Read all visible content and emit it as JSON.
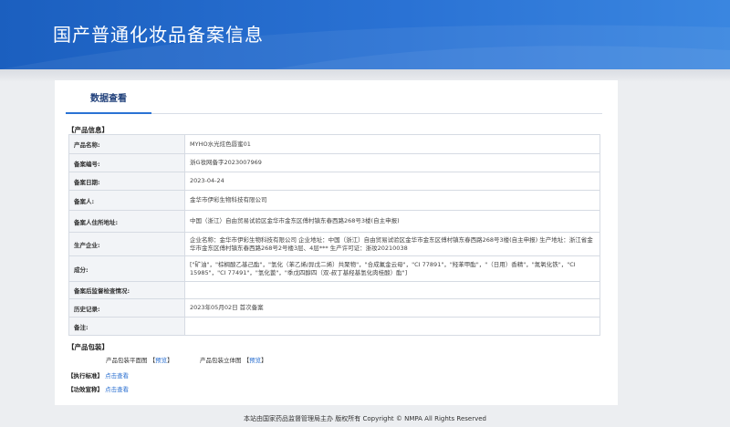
{
  "header": {
    "title": "国产普通化妆品备案信息"
  },
  "tabs": [
    {
      "label": "数据查看"
    }
  ],
  "product_info": {
    "section_title": "【产品信息】",
    "rows": [
      {
        "label": "产品名称:",
        "value": "MYHO水光炫色唇蜜01"
      },
      {
        "label": "备案编号:",
        "value": "浙G妆网备字2023007969"
      },
      {
        "label": "备案日期:",
        "value": "2023-04-24"
      },
      {
        "label": "备案人:",
        "value": "金华市伊彩生物科技有限公司"
      },
      {
        "label": "备案人住所地址:",
        "value": "中国（浙江）自由贸易试验区金华市金东区傅村镇东春西路268号3楼(自主申报)"
      },
      {
        "label": "生产企业:",
        "value": "企业名称：金华市伊彩生物科技有限公司 企业地址：中国（浙江）自由贸易试验区金华市金东区傅村镇东春西路268号3楼(自主申报) 生产地址：浙江省金华市金东区傅村镇东春西路268号2号楼3层、4层*** 生产许可证：浙妆20210038"
      },
      {
        "label": "成分:",
        "value": "[\"矿油\"，\"棕榈酸乙基己酯\"，\"氢化（苯乙烯/异戊二烯）共聚物\"，\"合成氟金云母\"，\"CI 77891\"，\"羟苯甲酯\"，\"（日用）香精\"，\"氮氧化铁\"，\"CI 15985\"，\"CI 77491\"，\"氢化蓖\"，\"季戊四醇四（双-叔丁基羟基氢化肉桂酸）酯\"]"
      },
      {
        "label": "备案后监督检查情况:",
        "value": ""
      },
      {
        "label": "历史记录:",
        "value": "2023年05月02日 首次备案"
      },
      {
        "label": "备注:",
        "value": ""
      }
    ]
  },
  "packaging": {
    "section_title": "【产品包装】",
    "flat_label": "产品包装平面图",
    "flat_link": "预览",
    "stereo_label": "产品包装立体图",
    "stereo_link": "预览"
  },
  "standard": {
    "section_title": "【执行标准】",
    "link": "点击查看"
  },
  "efficacy": {
    "section_title": "【功效宣称】",
    "link": "点击查看"
  },
  "footer": {
    "text": "本站由国家药品监督管理局主办 版权所有 Copyright © NMPA All Rights Reserved"
  }
}
